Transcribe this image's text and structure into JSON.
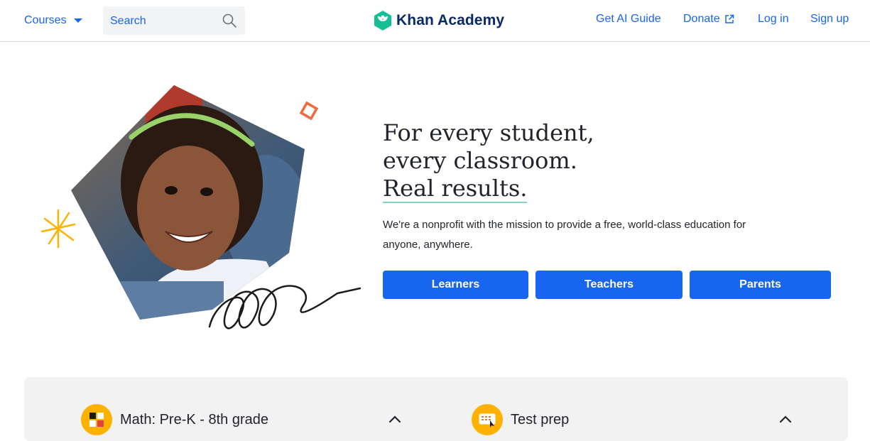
{
  "header": {
    "courses_label": "Courses",
    "search_placeholder": "Search",
    "logo_text": "Khan Academy",
    "nav": {
      "ai_guide": "Get AI Guide",
      "donate": "Donate",
      "login": "Log in",
      "signup": "Sign up"
    }
  },
  "hero": {
    "headline_lines": [
      "For every student,",
      "every classroom.",
      "Real results."
    ],
    "mission": "We're a nonprofit with the mission to provide a free, world-class education for anyone, anywhere.",
    "buttons": {
      "learners": "Learners",
      "teachers": "Teachers",
      "parents": "Parents"
    }
  },
  "subjects": {
    "math": "Math: Pre-K - 8th grade",
    "test_prep": "Test prep"
  },
  "colors": {
    "accent": "#1865f2",
    "logo_green": "#14bf96",
    "logo_text": "#0a2a66",
    "panel_bg": "#f2f2f2",
    "icon_gold": "#ffb100"
  }
}
